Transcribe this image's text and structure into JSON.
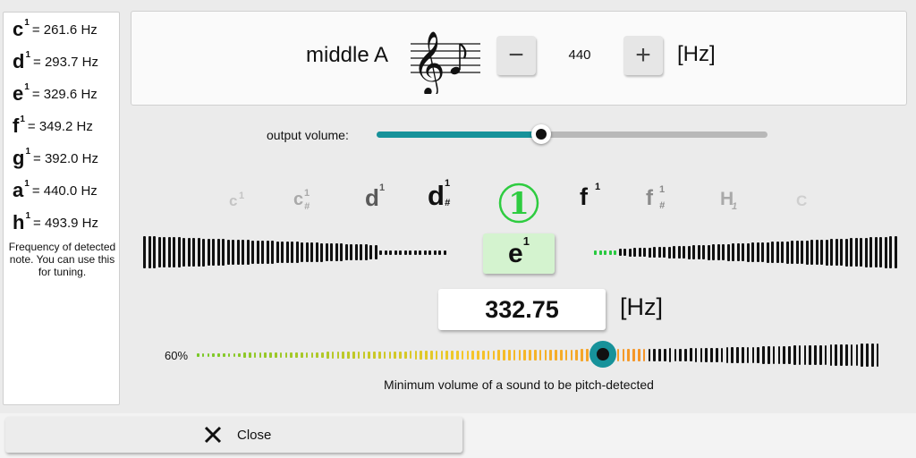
{
  "left_panel": {
    "frequencies": [
      {
        "note": "c",
        "octave": "1",
        "value": "= 261.6 Hz"
      },
      {
        "note": "d",
        "octave": "1",
        "value": "= 293.7 Hz"
      },
      {
        "note": "e",
        "octave": "1",
        "value": "= 329.6 Hz"
      },
      {
        "note": "f",
        "octave": "1",
        "value": "= 349.2 Hz"
      },
      {
        "note": "g",
        "octave": "1",
        "value": "= 392.0 Hz"
      },
      {
        "note": "a",
        "octave": "1",
        "value": "= 440.0 Hz"
      },
      {
        "note": "h",
        "octave": "1",
        "value": "= 493.9 Hz"
      }
    ],
    "caption": "Frequency of detected note. You can use this for tuning."
  },
  "reference": {
    "label": "middle A",
    "minus": "−",
    "plus": "+",
    "value": "440",
    "unit": "[Hz]"
  },
  "output_volume": {
    "label": "output volume:",
    "level": 0.42,
    "accent": "#17929a"
  },
  "notes": [
    {
      "name": "c",
      "sup": "1",
      "sub": "",
      "color": "#c4c4c4"
    },
    {
      "name": "c",
      "sup": "1",
      "sub": "#",
      "color": "#a9a9a9"
    },
    {
      "name": "d",
      "sup": "1",
      "sub": "",
      "color": "#5a5a5a"
    },
    {
      "name": "d",
      "sup": "1",
      "sub": "#",
      "color": "#111111"
    },
    {
      "name": "f",
      "sup": "1",
      "sub": "",
      "color": "#111111"
    },
    {
      "name": "f",
      "sup": "1",
      "sub": "#",
      "color": "#8a8a8a"
    },
    {
      "name": "H",
      "sup": "",
      "sub": "1",
      "color": "#a9a9a9"
    },
    {
      "name": "C",
      "sup": "",
      "sub": "",
      "color": "#cfcfcf"
    }
  ],
  "current_indicator": {
    "glyph": "1",
    "color": "#2ecc40"
  },
  "detected": {
    "note": "e",
    "octave": "1",
    "frequency": "332.75",
    "unit": "[Hz]",
    "box_color": "#d4f3cf",
    "deviation": 0.2
  },
  "min_volume": {
    "percent": "60%",
    "level": 0.6,
    "caption": "Minimum volume of a sound to be pitch-detected"
  },
  "close": {
    "label": "Close",
    "icon": "close-icon"
  }
}
